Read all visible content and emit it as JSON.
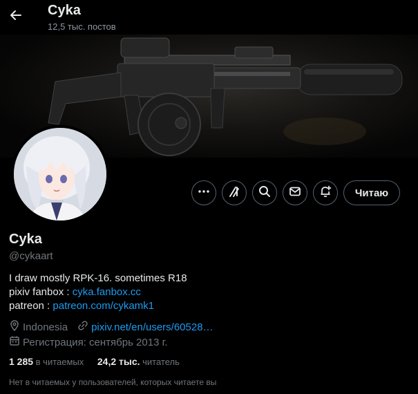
{
  "header": {
    "title": "Cyka",
    "posts_count": "12,5 тыс. постов",
    "back_icon": "arrow-left-icon"
  },
  "profile": {
    "name": "Cyka",
    "handle": "@cykaart",
    "bio_line1": "I draw mostly RPK-16. sometimes R18",
    "bio_fanbox_label": "pixiv fanbox : ",
    "bio_fanbox_link": "cyka.fanbox.cc",
    "bio_patreon_label": "patreon : ",
    "bio_patreon_link": "patreon.com/cykamk1",
    "location": "Indonesia",
    "website": "pixiv.net/en/users/60528…",
    "joined": "Регистрация: сентябрь 2013 г."
  },
  "actions": {
    "more_icon": "more-icon",
    "grok_icon": "grok-icon",
    "search_icon": "search-icon",
    "message_icon": "envelope-icon",
    "notify_icon": "bell-plus-icon",
    "follow_label": "Читаю"
  },
  "stats": {
    "following_count": "1 285",
    "following_label": " в читаемых",
    "followers_count": "24,2 тыс.",
    "followers_label": " читатель"
  },
  "note": "Нет в читаемых у пользователей, которых читаете вы",
  "colors": {
    "background": "#000000",
    "text": "#e7e9ea",
    "secondary": "#71767b",
    "link": "#1d9bf0",
    "border": "#536471"
  }
}
